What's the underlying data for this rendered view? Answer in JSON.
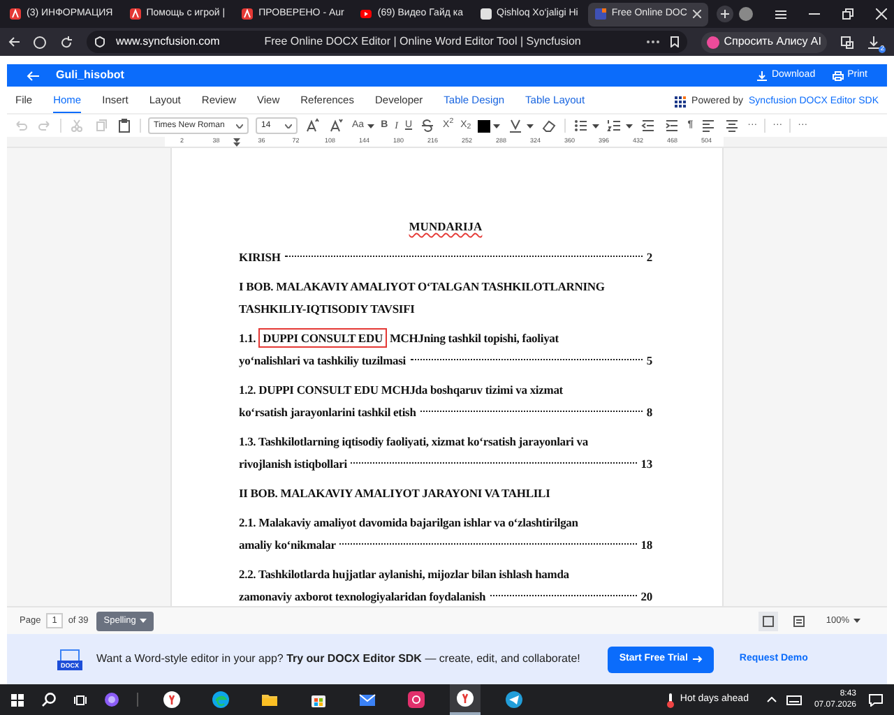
{
  "browser_tabs": [
    {
      "title": "(3) ИНФОРМАЦИЯ",
      "kind": "site",
      "selected": false
    },
    {
      "title": "Помощь с игрой |",
      "kind": "site",
      "selected": false
    },
    {
      "title": "ПРОВЕРЕНО - Aur",
      "kind": "site",
      "selected": false
    },
    {
      "title": "(69) Видео Гайд ка",
      "kind": "video",
      "selected": false
    },
    {
      "title": "Qishloq Xo‘jaligi Hi",
      "kind": "blank",
      "selected": false
    },
    {
      "title": "Free Online DOC",
      "kind": "docx",
      "selected": true
    }
  ],
  "address_bar": {
    "url": "www.syncfusion.com",
    "page_title": "Free Online DOCX Editor | Online Word Editor Tool | Syncfusion",
    "assistant": "Спросить Алису AI",
    "downloads_badge": "2"
  },
  "app_bar": {
    "document_name": "Guli_hisobot",
    "download": "Download",
    "print": "Print"
  },
  "ribbon_tabs": [
    {
      "label": "File",
      "selected": false,
      "contextual": false
    },
    {
      "label": "Home",
      "selected": true,
      "contextual": false
    },
    {
      "label": "Insert",
      "selected": false,
      "contextual": false
    },
    {
      "label": "Layout",
      "selected": false,
      "contextual": false
    },
    {
      "label": "Review",
      "selected": false,
      "contextual": false
    },
    {
      "label": "View",
      "selected": false,
      "contextual": false
    },
    {
      "label": "References",
      "selected": false,
      "contextual": false
    },
    {
      "label": "Developer",
      "selected": false,
      "contextual": false
    },
    {
      "label": "Table Design",
      "selected": false,
      "contextual": true
    },
    {
      "label": "Table Layout",
      "selected": false,
      "contextual": true
    }
  ],
  "brand": {
    "prefix": "Powered by",
    "name": "Syncfusion DOCX Editor SDK"
  },
  "toolbar": [
    {
      "kind": "undo",
      "disabled": true
    },
    {
      "kind": "redo",
      "disabled": true
    },
    {
      "kind": "sep"
    },
    {
      "kind": "cut",
      "disabled": true
    },
    {
      "kind": "copy",
      "disabled": true
    },
    {
      "kind": "paste",
      "disabled": false
    },
    {
      "kind": "sep"
    },
    {
      "kind": "select",
      "value": "Times New Roman",
      "wide": true
    },
    {
      "kind": "select",
      "value": "14",
      "wide": false
    },
    {
      "kind": "grow",
      "disabled": false
    },
    {
      "kind": "shrink",
      "disabled": false
    },
    {
      "kind": "case",
      "glyph": "Aa",
      "caret": true
    },
    {
      "kind": "bold",
      "glyph": "B",
      "caret": false
    },
    {
      "kind": "italic",
      "glyph": "I",
      "caret": false
    },
    {
      "kind": "underline",
      "glyph": "U",
      "caret": false
    },
    {
      "kind": "strike",
      "disabled": false
    },
    {
      "kind": "glyph",
      "glyph": "X$^{2}$",
      "caret": false
    },
    {
      "kind": "glyph",
      "glyph": "X$_{2}$",
      "caret": false
    },
    {
      "kind": "color",
      "color": "#000000"
    },
    {
      "kind": "highlight",
      "disabled": false
    },
    {
      "kind": "eraser",
      "disabled": false
    },
    {
      "kind": "sep"
    },
    {
      "kind": "bullets",
      "disabled": false
    },
    {
      "kind": "numbering",
      "disabled": false
    },
    {
      "kind": "outdent",
      "disabled": false
    },
    {
      "kind": "indent",
      "disabled": false
    },
    {
      "kind": "bold",
      "glyph": "¶",
      "caret": false
    },
    {
      "kind": "align-left",
      "disabled": false
    },
    {
      "kind": "align-center",
      "disabled": false
    },
    {
      "kind": "glyph",
      "glyph": "···",
      "caret": false
    },
    {
      "kind": "sep"
    },
    {
      "kind": "glyph",
      "glyph": "···",
      "caret": false
    },
    {
      "kind": "sep"
    },
    {
      "kind": "glyph",
      "glyph": "···",
      "caret": false
    }
  ],
  "ruler": [
    "2",
    "38",
    "36",
    "72",
    "108",
    "144",
    "180",
    "216",
    "252",
    "288",
    "324",
    "360",
    "396",
    "432",
    "468",
    "504"
  ],
  "document": {
    "title": "MUNDARIJA",
    "entries": [
      {
        "lines": [
          [
            {
              "text": "KIRISH",
              "boxed": false
            }
          ]
        ],
        "page": "2"
      },
      {
        "lines": [
          [
            {
              "text": "I BOB. MALAKAVIY AMALIYOT O‘TALGAN TASHKILOTLARNING",
              "boxed": false
            }
          ],
          [
            {
              "text": "TASHKILIY-IQTISODIY TAVSIFI",
              "boxed": false
            }
          ]
        ]
      },
      {
        "lines": [
          [
            {
              "text": "1.1.",
              "boxed": false
            },
            {
              "text": "DUPPI CONSULT EDU",
              "boxed": true
            },
            {
              "text": "MCHJning tashkil topishi, faoliyat",
              "boxed": false
            }
          ],
          [
            {
              "text": "yo‘nalishlari va tashkiliy tuzilmasi",
              "boxed": false
            }
          ]
        ],
        "page": "5"
      },
      {
        "lines": [
          [
            {
              "text": "1.2. DUPPI CONSULT EDU MCHJda boshqaruv tizimi va xizmat",
              "boxed": false
            }
          ],
          [
            {
              "text": "ko‘rsatish jarayonlarini tashkil etish",
              "boxed": false
            }
          ]
        ],
        "page": "8"
      },
      {
        "lines": [
          [
            {
              "text": "1.3. Tashkilotlarning iqtisodiy faoliyati, xizmat ko‘rsatish jarayonlari va",
              "boxed": false
            }
          ],
          [
            {
              "text": "rivojlanish istiqbollari",
              "boxed": false
            }
          ]
        ],
        "page": "13"
      },
      {
        "lines": [
          [
            {
              "text": "II BOB. MALAKAVIY AMALIYOT JARAYONI VA TAHLILI",
              "boxed": false
            }
          ]
        ]
      },
      {
        "lines": [
          [
            {
              "text": "2.1. Malakaviy amaliyot davomida bajarilgan ishlar va o‘zlashtirilgan",
              "boxed": false
            }
          ],
          [
            {
              "text": "amaliy ko‘nikmalar",
              "boxed": false
            }
          ]
        ],
        "page": "18"
      },
      {
        "lines": [
          [
            {
              "text": "2.2. Tashkilotlarda hujjatlar aylanishi, mijozlar bilan ishlash hamda",
              "boxed": false
            }
          ],
          [
            {
              "text": "zamonaviy axborot texnologiyalaridan foydalanish",
              "boxed": false
            }
          ]
        ],
        "page": "20"
      }
    ]
  },
  "status_bar": {
    "page_label": "Page",
    "page": "1",
    "page_total": "of 39",
    "spelling": "Spelling",
    "zoom": "100%"
  },
  "banner": {
    "icon_label": "DOCX",
    "text": "Want a Word-style editor in your app? **Try our DOCX Editor SDK** — create, edit, and collaborate!",
    "trial": "Start Free Trial",
    "demo": "Request Demo"
  },
  "taskbar": {
    "apps": [
      {
        "kind": "yandex",
        "selected": false
      },
      {
        "kind": "edge",
        "selected": false
      },
      {
        "kind": "folder",
        "selected": false
      },
      {
        "kind": "store",
        "selected": false
      },
      {
        "kind": "mail",
        "selected": false
      },
      {
        "kind": "instagram",
        "selected": false
      },
      {
        "kind": "yandex",
        "selected": true
      },
      {
        "kind": "telegram",
        "selected": false
      }
    ],
    "weather": "Hot days ahead",
    "time": "8:43",
    "date": "07.07.2026"
  }
}
